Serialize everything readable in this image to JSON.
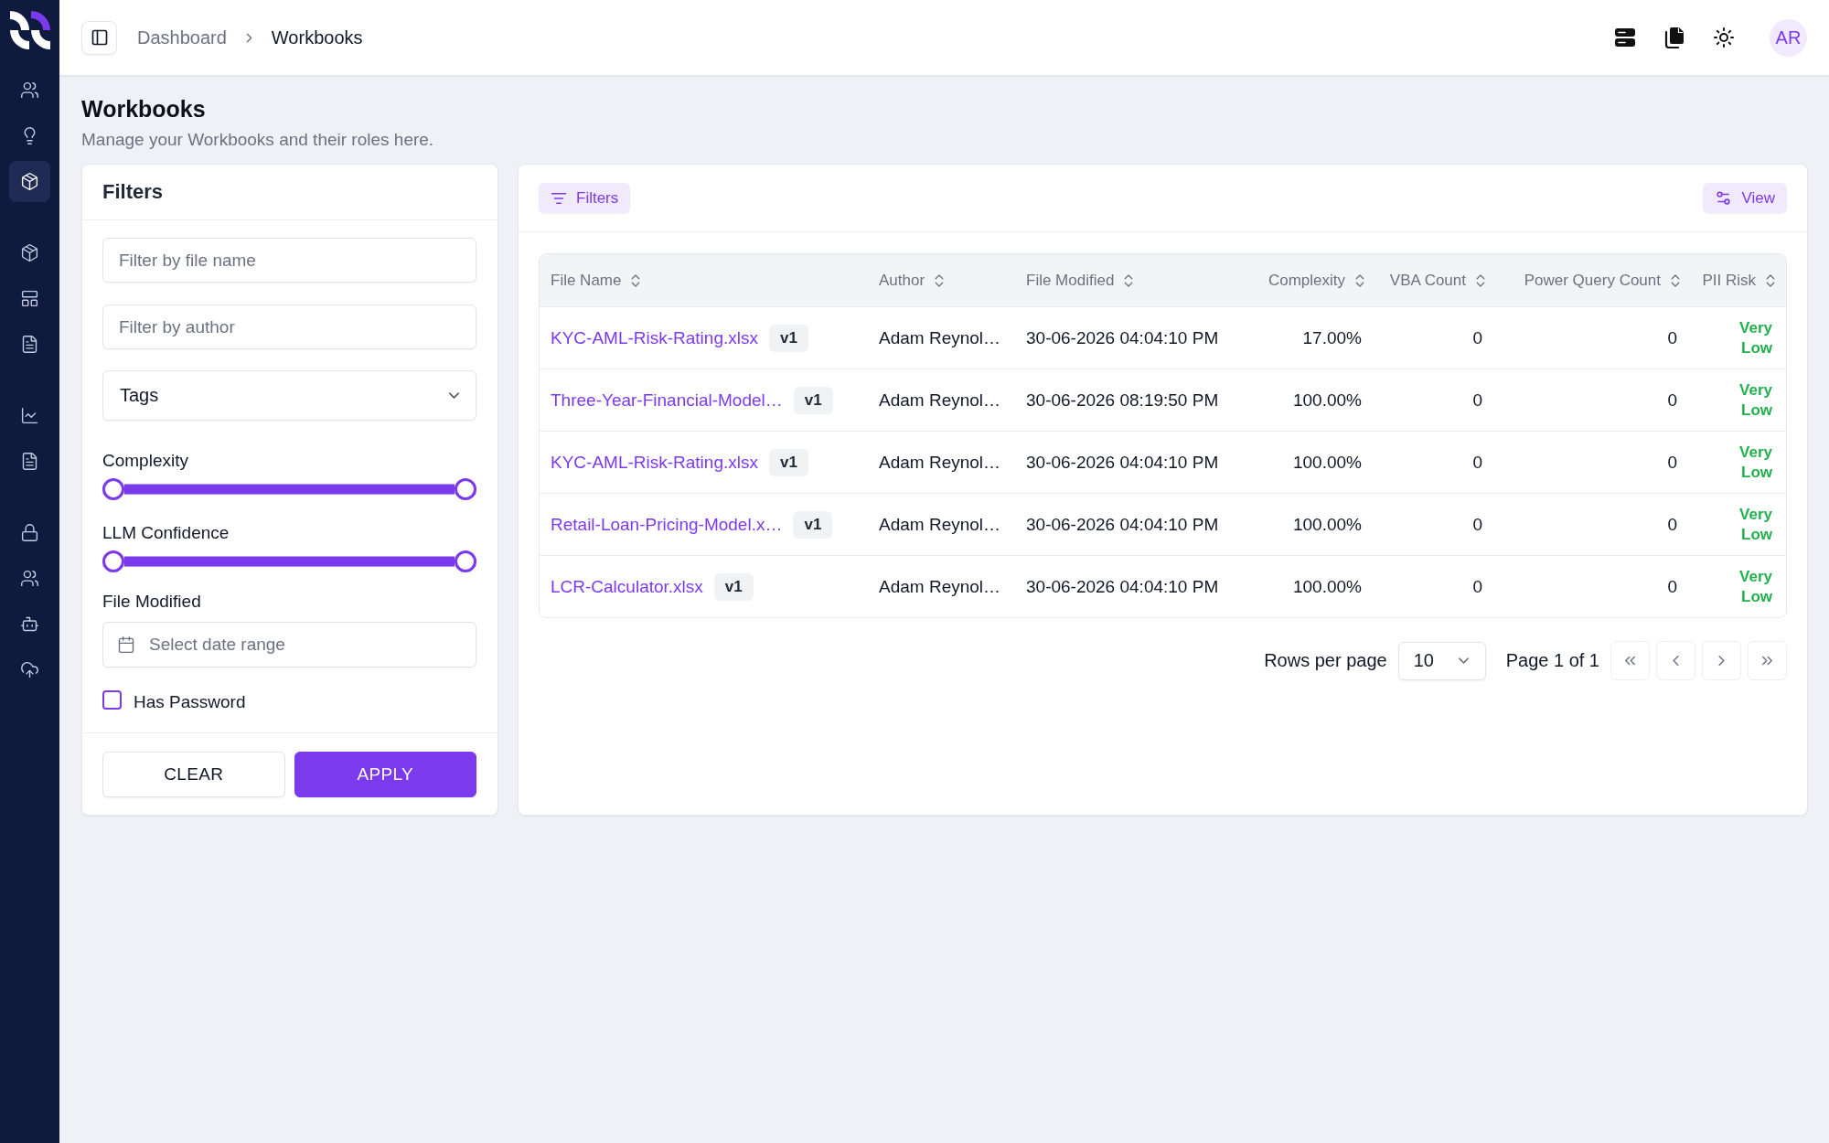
{
  "sidebar": {
    "groups": [
      {
        "items": [
          {
            "selected": false
          },
          {
            "selected": false
          },
          {
            "selected": true
          }
        ]
      },
      {
        "items": [
          {
            "selected": false
          },
          {
            "selected": false
          },
          {
            "selected": false
          }
        ]
      },
      {
        "items": [
          {
            "selected": false
          },
          {
            "selected": false
          }
        ]
      },
      {
        "items": [
          {
            "selected": false
          },
          {
            "selected": false
          },
          {
            "selected": false
          },
          {
            "selected": false
          }
        ]
      }
    ]
  },
  "header": {
    "breadcrumb": [
      {
        "label": "Dashboard",
        "current": false
      },
      {
        "label": "Workbooks",
        "current": true
      }
    ],
    "avatar": {
      "initials": "AR"
    }
  },
  "page": {
    "title": "Workbooks",
    "subtitle": "Manage your Workbooks and their roles here."
  },
  "filters": {
    "title": "Filters",
    "fields": [
      {
        "kind": "text",
        "placeholder": "Filter by file name"
      },
      {
        "kind": "text",
        "placeholder": "Filter by author"
      },
      {
        "kind": "select",
        "value": "Tags"
      }
    ],
    "sliders": [
      {
        "label": "Complexity",
        "thumbs": [
          {
            "level": 0
          },
          {
            "level": 1
          }
        ]
      },
      {
        "label": "LLM Confidence",
        "thumbs": [
          {
            "level": 0
          },
          {
            "level": 1
          }
        ]
      }
    ],
    "date": {
      "label": "File Modified",
      "placeholder": "Select date range"
    },
    "checkbox": {
      "label": "Has Password",
      "checked": false
    },
    "buttons": [
      {
        "kind": "secondary",
        "label": "CLEAR"
      },
      {
        "kind": "primary",
        "label": "APPLY"
      }
    ]
  },
  "toolbar": {
    "filters_button": "Filters",
    "view_button": "View"
  },
  "table": {
    "columns": [
      {
        "label": "File Name"
      },
      {
        "label": "Author"
      },
      {
        "label": "File Modified"
      },
      {
        "label": "Complexity"
      },
      {
        "label": "VBA Count"
      },
      {
        "label": "Power Query Count"
      },
      {
        "label": "PII Risk"
      }
    ],
    "rows": [
      {
        "file": {
          "name": "KYC-AML-Risk-Rating.xlsx",
          "version": "v1"
        },
        "author": "Adam Reynol…",
        "file_modified": "30-06-2026 04:04:10 PM",
        "complexity": "17.00%",
        "vba_count": "0",
        "power_query_count": "0",
        "pii_risk": "Very Low"
      },
      {
        "file": {
          "name": "Three-Year-Financial-Model…",
          "version": "v1"
        },
        "author": "Adam Reynol…",
        "file_modified": "30-06-2026 08:19:50 PM",
        "complexity": "100.00%",
        "vba_count": "0",
        "power_query_count": "0",
        "pii_risk": "Very Low"
      },
      {
        "file": {
          "name": "KYC-AML-Risk-Rating.xlsx",
          "version": "v1"
        },
        "author": "Adam Reynol…",
        "file_modified": "30-06-2026 04:04:10 PM",
        "complexity": "100.00%",
        "vba_count": "0",
        "power_query_count": "0",
        "pii_risk": "Very Low"
      },
      {
        "file": {
          "name": "Retail-Loan-Pricing-Model.x…",
          "version": "v1"
        },
        "author": "Adam Reynol…",
        "file_modified": "30-06-2026 04:04:10 PM",
        "complexity": "100.00%",
        "vba_count": "0",
        "power_query_count": "0",
        "pii_risk": "Very Low"
      },
      {
        "file": {
          "name": "LCR-Calculator.xlsx",
          "version": "v1"
        },
        "author": "Adam Reynol…",
        "file_modified": "30-06-2026 04:04:10 PM",
        "complexity": "100.00%",
        "vba_count": "0",
        "power_query_count": "0",
        "pii_risk": "Very Low"
      }
    ]
  },
  "pagination": {
    "rows_per_page_label": "Rows per page",
    "rows_per_page": "10",
    "page_info": "Page 1 of 1"
  }
}
